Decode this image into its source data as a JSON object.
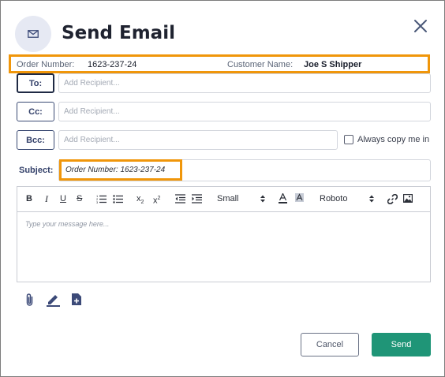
{
  "header": {
    "title": "Send Email",
    "icon": "envelope-icon",
    "close_icon": "close-icon"
  },
  "order_info": {
    "order_label": "Order Number:",
    "order_value": "1623-237-24",
    "customer_label": "Customer Name:",
    "customer_value": "Joe S Shipper",
    "highlight_color": "#f0960a"
  },
  "recipients": {
    "to": {
      "label": "To:",
      "placeholder": "Add Recipient..."
    },
    "cc": {
      "label": "Cc:",
      "placeholder": "Add Recipient..."
    },
    "bcc": {
      "label": "Bcc:",
      "placeholder": "Add Recipient..."
    }
  },
  "always_copy": {
    "label": "Always copy me in",
    "checked": false
  },
  "subject": {
    "label": "Subject:",
    "value": "Order Number: 1623-237-24"
  },
  "editor": {
    "toolbar": {
      "bold": "B",
      "italic": "I",
      "underline": "U",
      "strike": "S",
      "ordered_list": "ordered-list-icon",
      "bullet_list": "bullet-list-icon",
      "subscript": "x",
      "subscript_mark": "2",
      "superscript": "x",
      "superscript_mark": "2",
      "outdent": "outdent-icon",
      "indent": "indent-icon",
      "size_value": "Small",
      "font_color": "font-color-icon",
      "highlight": "highlight-icon",
      "font_value": "Roboto",
      "link": "link-icon",
      "image": "image-icon"
    },
    "placeholder": "Type your message here..."
  },
  "attachments": {
    "icons": [
      "paperclip-icon",
      "pen-icon",
      "add-document-icon"
    ]
  },
  "actions": {
    "cancel_label": "Cancel",
    "send_label": "Send",
    "send_color": "#1f9577"
  }
}
